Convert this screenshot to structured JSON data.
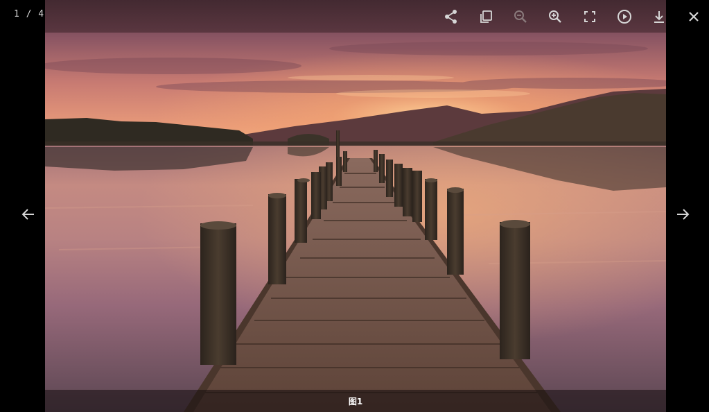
{
  "viewer": {
    "counter": "1 / 4",
    "caption": "图1"
  },
  "toolbar": {
    "buttons": [
      {
        "name": "share",
        "icon": "share-icon",
        "enabled": true
      },
      {
        "name": "actual-size",
        "icon": "actual-size-icon",
        "enabled": true
      },
      {
        "name": "zoom-out",
        "icon": "zoom-out-icon",
        "enabled": false
      },
      {
        "name": "zoom-in",
        "icon": "zoom-in-icon",
        "enabled": true
      },
      {
        "name": "fullscreen",
        "icon": "fullscreen-icon",
        "enabled": true
      },
      {
        "name": "slideshow",
        "icon": "play-icon",
        "enabled": true
      },
      {
        "name": "download",
        "icon": "download-icon",
        "enabled": true
      },
      {
        "name": "close",
        "icon": "close-icon",
        "enabled": true
      }
    ]
  },
  "navigation": {
    "prev_icon": "arrow-left-icon",
    "next_icon": "arrow-right-icon"
  },
  "colors": {
    "icon": "#d6d6d6",
    "icon_disabled": "#8a7a7c",
    "backdrop": "#000000"
  }
}
